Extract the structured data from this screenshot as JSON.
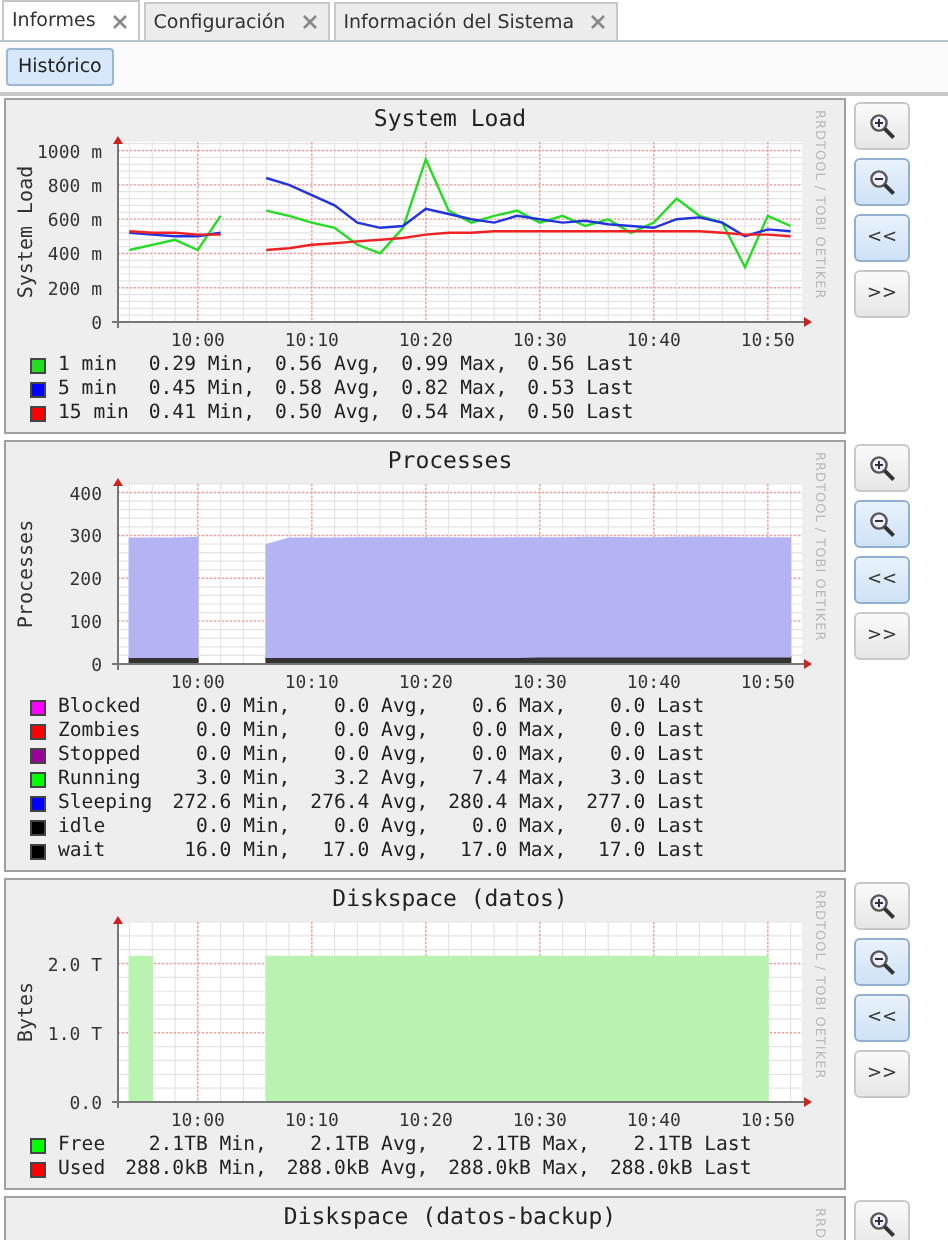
{
  "tabs": [
    {
      "label": "Informes",
      "selected": true
    },
    {
      "label": "Configuración",
      "selected": false
    },
    {
      "label": "Información del Sistema",
      "selected": false
    }
  ],
  "toolbar": {
    "button": "Histórico"
  },
  "panels": [
    {
      "credit": "RRDTOOL / TOBI OETIKER",
      "chart_data": {
        "type": "line",
        "grid": true,
        "title": "System Load",
        "ylabel": "System Load",
        "categories": [
          null,
          null,
          null,
          "10:00",
          null,
          null,
          null,
          null,
          "10:10",
          null,
          null,
          null,
          null,
          "10:20",
          null,
          null,
          null,
          null,
          "10:30",
          null,
          null,
          null,
          null,
          "10:40",
          null,
          null,
          null,
          null,
          "10:50",
          null
        ],
        "ylim": [
          0,
          1050
        ],
        "yticks": [
          {
            "value": 0,
            "label": "0"
          },
          {
            "value": 200,
            "label": "200 m"
          },
          {
            "value": 400,
            "label": "400 m"
          },
          {
            "value": 600,
            "label": "600 m"
          },
          {
            "value": 800,
            "label": "800 m"
          },
          {
            "value": 1000,
            "label": "1000 m"
          }
        ],
        "series": [
          {
            "color": "#22dd22",
            "values": [
              420,
              450,
              480,
              420,
              620,
              null,
              650,
              620,
              580,
              550,
              450,
              400,
              550,
              950,
              650,
              580,
              620,
              650,
              580,
              620,
              560,
              600,
              520,
              580,
              720,
              620,
              580,
              320,
              620,
              560
            ]
          },
          {
            "color": "#2233dd",
            "values": [
              520,
              510,
              500,
              500,
              520,
              null,
              840,
              800,
              740,
              680,
              580,
              550,
              560,
              660,
              630,
              600,
              580,
              620,
              600,
              580,
              590,
              570,
              560,
              550,
              600,
              610,
              580,
              500,
              540,
              530
            ]
          },
          {
            "color": "#ee2222",
            "values": [
              530,
              520,
              520,
              510,
              510,
              null,
              420,
              430,
              450,
              460,
              470,
              480,
              490,
              510,
              520,
              520,
              530,
              530,
              530,
              530,
              530,
              530,
              530,
              530,
              530,
              530,
              520,
              510,
              510,
              500
            ]
          }
        ]
      },
      "legend": [
        {
          "label": "1 min",
          "color": "#22dd22",
          "min": "0.29 Min,",
          "avg": "0.56 Avg,",
          "max": "0.99 Max,",
          "last": "0.56 Last"
        },
        {
          "label": "5 min",
          "color": "#0000ff",
          "min": "0.45 Min,",
          "avg": "0.58 Avg,",
          "max": "0.82 Max,",
          "last": "0.53 Last"
        },
        {
          "label": "15 min",
          "color": "#ff0000",
          "min": "0.41 Min,",
          "avg": "0.50 Avg,",
          "max": "0.54 Max,",
          "last": "0.50 Last"
        }
      ],
      "buttons": [
        {
          "kind": "zoom-in",
          "highlighted": false
        },
        {
          "kind": "zoom-out",
          "highlighted": true
        },
        {
          "kind": "text",
          "label": "<<",
          "highlighted": true
        },
        {
          "kind": "text",
          "label": ">>",
          "highlighted": false
        }
      ]
    },
    {
      "credit": "RRDTOOL / TOBI OETIKER",
      "chart_data": {
        "type": "area",
        "grid": true,
        "stacked": true,
        "title": "Processes",
        "ylabel": "Processes",
        "categories": [
          null,
          null,
          null,
          "10:00",
          null,
          null,
          null,
          null,
          "10:10",
          null,
          null,
          null,
          null,
          "10:20",
          null,
          null,
          null,
          null,
          "10:30",
          null,
          null,
          null,
          null,
          "10:40",
          null,
          null,
          null,
          null,
          "10:50",
          null
        ],
        "ylim": [
          0,
          420
        ],
        "yticks": [
          0,
          100,
          200,
          300,
          400
        ],
        "series": [
          {
            "color": "#333333",
            "values": [
              16,
              16,
              16,
              16,
              null,
              null,
              16,
              16,
              16,
              16,
              16,
              16,
              16,
              16,
              16,
              16,
              16,
              16,
              17,
              17,
              17,
              17,
              17,
              17,
              17,
              17,
              17,
              17,
              17,
              17
            ]
          },
          {
            "color": "#b4b4f4",
            "values": [
              277,
              277,
              277,
              279,
              null,
              null,
              262,
              277,
              277,
              277,
              278,
              278,
              278,
              278,
              278,
              277,
              277,
              278,
              277,
              277,
              278,
              278,
              277,
              277,
              278,
              279,
              278,
              277,
              277,
              277
            ]
          }
        ]
      },
      "legend": [
        {
          "label": "Blocked",
          "color": "#ff00ff",
          "min": "0.0 Min,",
          "avg": "0.0 Avg,",
          "max": "0.6 Max,",
          "last": "0.0 Last"
        },
        {
          "label": "Zombies",
          "color": "#ff0000",
          "min": "0.0 Min,",
          "avg": "0.0 Avg,",
          "max": "0.0 Max,",
          "last": "0.0 Last"
        },
        {
          "label": "Stopped",
          "color": "#990099",
          "min": "0.0 Min,",
          "avg": "0.0 Avg,",
          "max": "0.0 Max,",
          "last": "0.0 Last"
        },
        {
          "label": "Running",
          "color": "#00ff00",
          "min": "3.0 Min,",
          "avg": "3.2 Avg,",
          "max": "7.4 Max,",
          "last": "3.0 Last"
        },
        {
          "label": "Sleeping",
          "color": "#0000ff",
          "min": "272.6 Min,",
          "avg": "276.4 Avg,",
          "max": "280.4 Max,",
          "last": "277.0 Last"
        },
        {
          "label": "idle",
          "color": "#000000",
          "min": "0.0 Min,",
          "avg": "0.0 Avg,",
          "max": "0.0 Max,",
          "last": "0.0 Last"
        },
        {
          "label": "wait",
          "color": "#000000",
          "min": "16.0 Min,",
          "avg": "17.0 Avg,",
          "max": "17.0 Max,",
          "last": "17.0 Last"
        }
      ],
      "buttons": [
        {
          "kind": "zoom-in",
          "highlighted": false
        },
        {
          "kind": "zoom-out",
          "highlighted": true
        },
        {
          "kind": "text",
          "label": "<<",
          "highlighted": true
        },
        {
          "kind": "text",
          "label": ">>",
          "highlighted": false
        }
      ]
    },
    {
      "credit": "RRDTOOL / TOBI OETIKER",
      "chart_data": {
        "type": "area",
        "grid": true,
        "title": "Diskspace (datos)",
        "ylabel": "Bytes",
        "categories": [
          null,
          null,
          null,
          "10:00",
          null,
          null,
          null,
          null,
          "10:10",
          null,
          null,
          null,
          null,
          "10:20",
          null,
          null,
          null,
          null,
          "10:30",
          null,
          null,
          null,
          null,
          "10:40",
          null,
          null,
          null,
          null,
          "10:50",
          null
        ],
        "ylim": [
          0,
          2.6
        ],
        "yticks": [
          {
            "value": 0,
            "label": "0.0"
          },
          {
            "value": 1,
            "label": "1.0 T"
          },
          {
            "value": 2,
            "label": "2.0 T"
          }
        ],
        "series": [
          {
            "color": "#b8f4b0",
            "values": [
              2.1,
              2.1,
              null,
              null,
              null,
              null,
              2.1,
              2.1,
              2.1,
              2.1,
              2.1,
              2.1,
              2.1,
              2.1,
              2.1,
              2.1,
              2.1,
              2.1,
              2.1,
              2.1,
              2.1,
              2.1,
              2.1,
              2.1,
              2.1,
              2.1,
              2.1,
              2.1,
              2.1,
              null
            ]
          }
        ]
      },
      "legend": [
        {
          "label": "Free",
          "color": "#00ff00",
          "min": "2.1TB Min,",
          "avg": "2.1TB Avg,",
          "max": "2.1TB Max,",
          "last": "2.1TB Last"
        },
        {
          "label": "Used",
          "color": "#ff0000",
          "min": "288.0kB Min,",
          "avg": "288.0kB Avg,",
          "max": "288.0kB Max,",
          "last": "288.0kB Last"
        }
      ],
      "buttons": [
        {
          "kind": "zoom-in",
          "highlighted": false
        },
        {
          "kind": "zoom-out",
          "highlighted": true
        },
        {
          "kind": "text",
          "label": "<<",
          "highlighted": true
        },
        {
          "kind": "text",
          "label": ">>",
          "highlighted": false
        }
      ]
    },
    {
      "credit": "RRD",
      "title": "Diskspace (datos-backup)",
      "buttons": [
        {
          "kind": "zoom-in",
          "highlighted": false
        }
      ]
    }
  ]
}
